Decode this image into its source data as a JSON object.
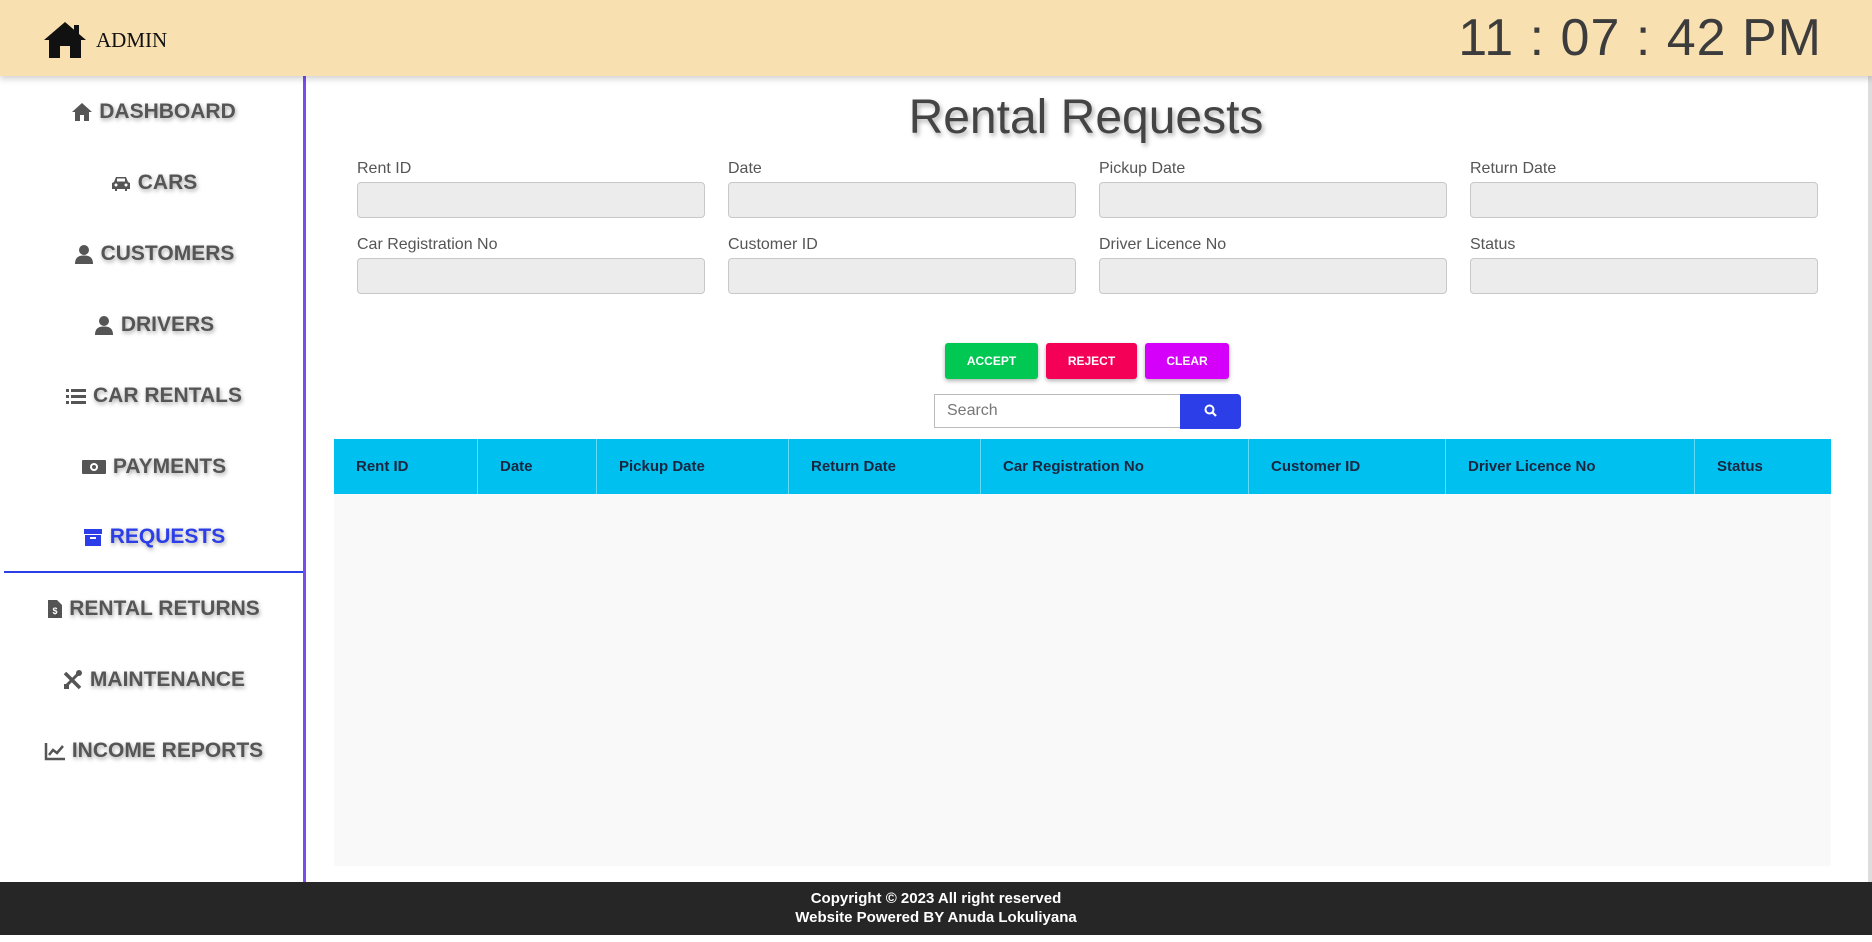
{
  "header": {
    "brand_label": "ADMIN",
    "clock": "11 : 07 : 42 PM"
  },
  "sidebar": {
    "items": [
      {
        "label": "DASHBOARD",
        "icon": "home-icon"
      },
      {
        "label": "CARS",
        "icon": "car-icon"
      },
      {
        "label": "CUSTOMERS",
        "icon": "user-icon"
      },
      {
        "label": "DRIVERS",
        "icon": "user-icon"
      },
      {
        "label": "CAR RENTALS",
        "icon": "list-icon"
      },
      {
        "label": "PAYMENTS",
        "icon": "money-icon"
      },
      {
        "label": "REQUESTS",
        "icon": "archive-icon",
        "active": true
      },
      {
        "label": "RENTAL RETURNS",
        "icon": "invoice-icon"
      },
      {
        "label": "MAINTENANCE",
        "icon": "tools-icon"
      },
      {
        "label": "INCOME REPORTS",
        "icon": "chart-line-icon"
      }
    ]
  },
  "main": {
    "title": "Rental Requests",
    "fields": [
      {
        "label": "Rent ID",
        "value": ""
      },
      {
        "label": "Date",
        "value": ""
      },
      {
        "label": "Pickup Date",
        "value": ""
      },
      {
        "label": "Return Date",
        "value": ""
      },
      {
        "label": "Car Registration No",
        "value": ""
      },
      {
        "label": "Customer ID",
        "value": ""
      },
      {
        "label": "Driver Licence No",
        "value": ""
      },
      {
        "label": "Status",
        "value": ""
      }
    ],
    "buttons": {
      "accept": "ACCEPT",
      "reject": "REJECT",
      "clear": "CLEAR"
    },
    "search": {
      "placeholder": "Search",
      "value": ""
    },
    "table": {
      "columns": [
        "Rent ID",
        "Date",
        "Pickup Date",
        "Return Date",
        "Car Registration No",
        "Customer ID",
        "Driver Licence No",
        "Status"
      ],
      "rows": []
    }
  },
  "footer": {
    "line1": "Copyright © 2023 All right reserved",
    "line2": "Website Powered BY Anuda Lokuliyana"
  },
  "colors": {
    "header_bg": "#f8e0b0",
    "sidebar_border": "#7a4cf0",
    "active": "#2c3ee8",
    "accept": "#00c853",
    "reject": "#f50057",
    "clear": "#d500f9",
    "table_header": "#00c0ef",
    "footer_bg": "#262626"
  }
}
